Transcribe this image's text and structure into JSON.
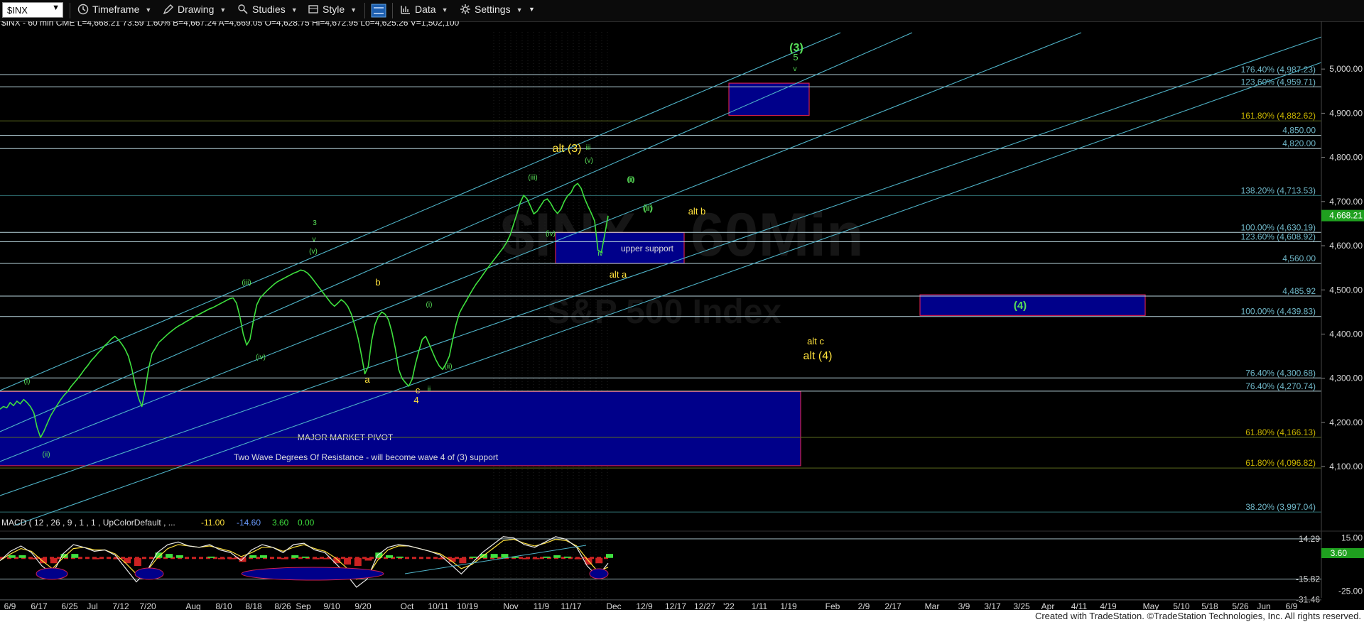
{
  "toolbar": {
    "symbol": "$INX",
    "items": [
      "Timeframe",
      "Drawing",
      "Studies",
      "Style",
      "Data",
      "Settings"
    ]
  },
  "colors": {
    "price": "#3ee03e",
    "channel": "#4fb3c8",
    "level_line": "#b8d4dc",
    "fib_line": "#5d6b1e",
    "box_fill": "#00008a",
    "box_border": "#d02050",
    "label_yellow": "#ffe23c",
    "label_green": "#58e058",
    "fib_text": "#6fb7c8",
    "fib_text_gold": "#c8b400"
  },
  "chart_data": [
    {
      "type": "line",
      "info_bar": "$INX - 60 min  CME  L=4,668.21  73.59  1.60%  B=4,667.24  A=4,669.05  O=4,628.75  Hi=4,672.95  Lo=4,625.26  V=1,502,100",
      "watermark": "$INX - 60Min",
      "watermark_sub": "S&P 500 Index",
      "y_axis": {
        "ylim": [
          3970,
          5100
        ],
        "ticks": [
          "5,000.00",
          "4,900.00",
          "4,800.00",
          "4,700.00",
          "4,600.00",
          "4,500.00",
          "4,400.00",
          "4,300.00",
          "4,200.00",
          "4,100.00"
        ],
        "last_price": "4,668.21"
      },
      "x_axis": {
        "ticks": [
          "6/9",
          "6/17",
          "6/25",
          "Jul",
          "7/12",
          "7/20",
          "Aug",
          "8/10",
          "8/18",
          "8/26",
          "Sep",
          "9/10",
          "9/20",
          "Oct",
          "10/11",
          "10/19",
          "Nov",
          "11/9",
          "11/17",
          "Dec",
          "12/9",
          "12/17",
          "12/27",
          "'22",
          "1/11",
          "1/19",
          "Feb",
          "2/9",
          "2/17",
          "Mar",
          "3/9",
          "3/17",
          "3/25",
          "Apr",
          "4/11",
          "4/19",
          "May",
          "5/10",
          "5/18",
          "5/26",
          "Jun",
          "6/9"
        ]
      },
      "series": [
        {
          "values": [
            4230,
            4236,
            4233,
            4245,
            4238,
            4248,
            4242,
            4252,
            4245,
            4236,
            4222,
            4188,
            4166,
            4180,
            4198,
            4215,
            4228,
            4240,
            4252,
            4262,
            4270,
            4281,
            4290,
            4299,
            4309,
            4320,
            4329,
            4340,
            4348,
            4357,
            4365,
            4374,
            4381,
            4389,
            4395,
            4388,
            4378,
            4366,
            4350,
            4322,
            4285,
            4255,
            4236,
            4275,
            4322,
            4356,
            4368,
            4381,
            4388,
            4395,
            4402,
            4408,
            4414,
            4419,
            4423,
            4428,
            4432,
            4437,
            4441,
            4445,
            4449,
            4453,
            4457,
            4460,
            4464,
            4468,
            4472,
            4476,
            4480,
            4482,
            4470,
            4440,
            4400,
            4375,
            4388,
            4430,
            4466,
            4482,
            4490,
            4498,
            4505,
            4512,
            4518,
            4522,
            4526,
            4530,
            4534,
            4538,
            4541,
            4545,
            4543,
            4538,
            4530,
            4520,
            4510,
            4500,
            4490,
            4480,
            4470,
            4463,
            4470,
            4478,
            4472,
            4462,
            4445,
            4420,
            4390,
            4352,
            4310,
            4327,
            4385,
            4422,
            4440,
            4450,
            4445,
            4432,
            4405,
            4368,
            4320,
            4300,
            4290,
            4282,
            4298,
            4333,
            4362,
            4388,
            4395,
            4378,
            4360,
            4342,
            4328,
            4320,
            4333,
            4350,
            4388,
            4422,
            4448,
            4462,
            4475,
            4489,
            4502,
            4514,
            4524,
            4535,
            4546,
            4556,
            4566,
            4576,
            4586,
            4596,
            4608,
            4624,
            4648,
            4672,
            4698,
            4714,
            4706,
            4690,
            4672,
            4678,
            4690,
            4702,
            4706,
            4696,
            4682,
            4673,
            4682,
            4700,
            4713,
            4720,
            4735,
            4741,
            4730,
            4708,
            4690,
            4674,
            4656,
            4590,
            4585,
            4625,
            4668
          ]
        }
      ]
    },
    {
      "type": "line",
      "title": "MACD ( 12 , 26 , 9 , 1 , 1 , UpColorDefault , ...",
      "readout": [
        "-11.00",
        "-14.60",
        "3.60",
        "0.00"
      ],
      "y_axis": {
        "ylim": [
          -30,
          18
        ],
        "ticks": [
          "15.00",
          "-25.00"
        ],
        "levels": [
          "14.29",
          "-15.82",
          "-31.46"
        ],
        "last_value": "3.60"
      },
      "series": [
        {
          "values": [
            -2,
            5,
            9,
            4,
            -6,
            -12,
            3,
            10,
            8,
            5,
            6,
            2,
            -8,
            -18,
            -10,
            4,
            10,
            12,
            9,
            8,
            10,
            6,
            4,
            -2,
            6,
            10,
            8,
            4,
            10,
            11,
            6,
            4,
            -4,
            -12,
            -22,
            -16,
            2,
            8,
            10,
            9,
            7,
            5,
            2,
            -5,
            -12,
            -4,
            4,
            10,
            16,
            15,
            10,
            8,
            12,
            16,
            14,
            8,
            -6,
            -14,
            -4
          ]
        },
        {
          "values": [
            -2,
            3,
            7,
            5,
            -2,
            -8,
            0,
            7,
            8,
            6,
            6,
            3,
            -4,
            -12,
            -10,
            0,
            7,
            10,
            9,
            8,
            9,
            7,
            5,
            1,
            4,
            8,
            8,
            5,
            8,
            10,
            7,
            5,
            0,
            -7,
            -16,
            -14,
            -2,
            6,
            9,
            9,
            7,
            5,
            3,
            -2,
            -8,
            -5,
            1,
            7,
            13,
            14,
            11,
            9,
            11,
            14,
            13,
            9,
            -1,
            -10,
            -7
          ]
        }
      ]
    }
  ],
  "levels": [
    {
      "label": "176.40% (4,987.23)",
      "value": 4987.23,
      "style": "level"
    },
    {
      "label": "123.60% (4,959.71)",
      "value": 4959.71,
      "style": "level"
    },
    {
      "label": "161.80% (4,882.62)",
      "value": 4882.62,
      "style": "gold"
    },
    {
      "label": "4,850.00",
      "value": 4850,
      "style": "level"
    },
    {
      "label": "4,820.00",
      "value": 4820,
      "style": "level"
    },
    {
      "label": "138.20% (4,713.53)",
      "value": 4713.53,
      "style": "teal"
    },
    {
      "label": "100.00% (4,630.19)",
      "value": 4630.19,
      "style": "level"
    },
    {
      "label": "123.60% (4,608.92)",
      "value": 4608.92,
      "style": "level"
    },
    {
      "label": "4,560.00",
      "value": 4560,
      "style": "level"
    },
    {
      "label": "4,485.92",
      "value": 4485.92,
      "style": "level"
    },
    {
      "label": "100.00% (4,439.83)",
      "value": 4439.83,
      "style": "level"
    },
    {
      "label": "76.40% (4,300.68)",
      "value": 4300.68,
      "style": "level"
    },
    {
      "label": "76.40% (4,270.74)",
      "value": 4270.74,
      "style": "level"
    },
    {
      "label": "61.80% (4,166.13)",
      "value": 4166.13,
      "style": "gold"
    },
    {
      "label": "61.80% (4,096.82)",
      "value": 4096.82,
      "style": "gold"
    },
    {
      "label": "38.20% (3,997.04)",
      "value": 3997.04,
      "style": "teal"
    }
  ],
  "boxes": [
    {
      "label": "MAJOR MARKET PIVOT",
      "label2": "Two Wave Degrees Of Resistance - will become wave 4 of (3) support"
    },
    {
      "label": "upper support"
    },
    {
      "label": "(4)"
    },
    {
      "label": ""
    }
  ],
  "wave_labels": {
    "yellow": [
      "alt (3)",
      "alt b",
      "alt a",
      "alt c",
      "alt (4)",
      "a",
      "b",
      "c",
      "4"
    ],
    "green": [
      "(3)",
      "5",
      "v",
      "iii",
      "(v)",
      "(iii)",
      "(iv)",
      "iv",
      "(i)",
      "(ii)",
      "3",
      "v",
      "(v)",
      "(iii)",
      "(iv)",
      "(i)",
      "(ii)",
      "(i)",
      "(ii)",
      "ii",
      "(ii)",
      "(ii)"
    ]
  },
  "footer": "Created with TradeStation. ©TradeStation Technologies, Inc. All rights reserved."
}
